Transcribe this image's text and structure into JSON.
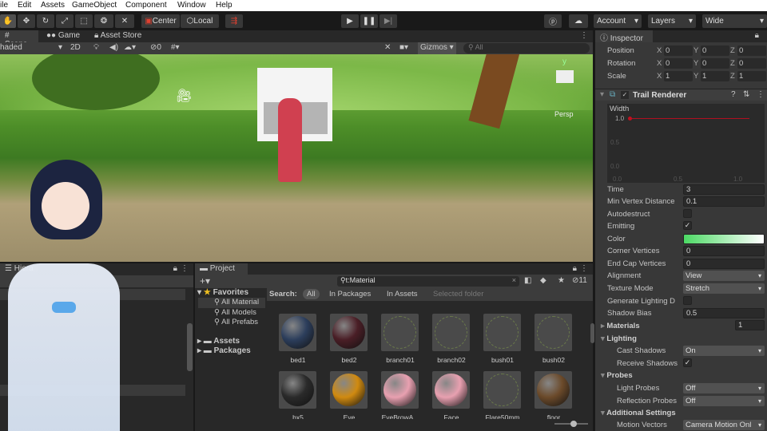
{
  "menu": [
    "ile",
    "Edit",
    "Assets",
    "GameObject",
    "Component",
    "Window",
    "Help"
  ],
  "toolbar": {
    "center": "Center",
    "local": "Local",
    "account": "Account",
    "layers": "Layers",
    "layout": "Wide"
  },
  "scene_tabs": {
    "scene": "Scene",
    "game": "Game",
    "asset_store": "Asset Store"
  },
  "scene_toolbar": {
    "shading": "haded",
    "mode_2d": "2D",
    "hidden_count": "0",
    "gizmos": "Gizmos",
    "search_placeholder": "All"
  },
  "scene_view": {
    "persp": "Persp",
    "axis_y": "y"
  },
  "inspector": {
    "tab": "Inspector",
    "transform": [
      {
        "label": "Position",
        "x": "0",
        "y": "0",
        "z": "0"
      },
      {
        "label": "Rotation",
        "x": "0",
        "y": "0",
        "z": "0"
      },
      {
        "label": "Scale",
        "x": "1",
        "y": "1",
        "z": "1"
      }
    ],
    "component": "Trail Renderer",
    "curve": {
      "title": "Width",
      "y_ticks": [
        "1.0",
        "0.5",
        "0.0"
      ],
      "x_ticks": [
        "0.0",
        "0.5",
        "1.0"
      ],
      "value": 1.0
    },
    "time_label": "Time",
    "time": "3",
    "min_vertex_label": "Min Vertex Distance",
    "min_vertex": "0.1",
    "autodestruct_label": "Autodestruct",
    "emitting_label": "Emitting",
    "color_label": "Color",
    "color_start": "#4cd964",
    "color_end": "#ffffff",
    "corner_label": "Corner Vertices",
    "corner": "0",
    "endcap_label": "End Cap Vertices",
    "endcap": "0",
    "alignment_label": "Alignment",
    "alignment": "View",
    "texture_label": "Texture Mode",
    "texture": "Stretch",
    "genlight_label": "Generate Lighting D",
    "shadowbias_label": "Shadow Bias",
    "shadowbias": "0.5",
    "materials_label": "Materials",
    "materials": "1",
    "lighting_label": "Lighting",
    "cast_label": "Cast Shadows",
    "cast": "On",
    "receive_label": "Receive Shadows",
    "probes_label": "Probes",
    "lightprobes_label": "Light Probes",
    "lightprobes": "Off",
    "reflprobes_label": "Reflection Probes",
    "reflprobes": "Off",
    "additional_label": "Additional Settings",
    "motion_label": "Motion Vectors",
    "motion": "Camera Motion Onl"
  },
  "hierarchy": {
    "tab": "Hiera"
  },
  "project": {
    "tab": "Project",
    "search": "t:Material",
    "hidden_count": "11",
    "favorites": "Favorites",
    "fav_items": [
      "All Material",
      "All Models",
      "All Prefabs"
    ],
    "folders": [
      "Assets",
      "Packages"
    ],
    "search_label": "Search:",
    "scopes": [
      "All",
      "In Packages",
      "In Assets",
      "Selected folder"
    ],
    "items": [
      {
        "name": "bed1",
        "color": "#2c3e5c"
      },
      {
        "name": "bed2",
        "color": "#4a1e26"
      },
      {
        "name": "branch01",
        "color": "#4a4a4a"
      },
      {
        "name": "branch02",
        "color": "#4a4a4a"
      },
      {
        "name": "bush01",
        "color": "#4a4a4a"
      },
      {
        "name": "bush02",
        "color": "#4a4a4a"
      },
      {
        "name": "bx5",
        "color": "#2a2a2a"
      },
      {
        "name": "Eye",
        "color": "#d08a10"
      },
      {
        "name": "EyeBrowA...",
        "color": "#e8a0b0"
      },
      {
        "name": "Face",
        "color": "#e8a0b0"
      },
      {
        "name": "Flare50mm",
        "color": "#4a4a4a"
      },
      {
        "name": "floor",
        "color": "#6b4a2a"
      }
    ]
  }
}
